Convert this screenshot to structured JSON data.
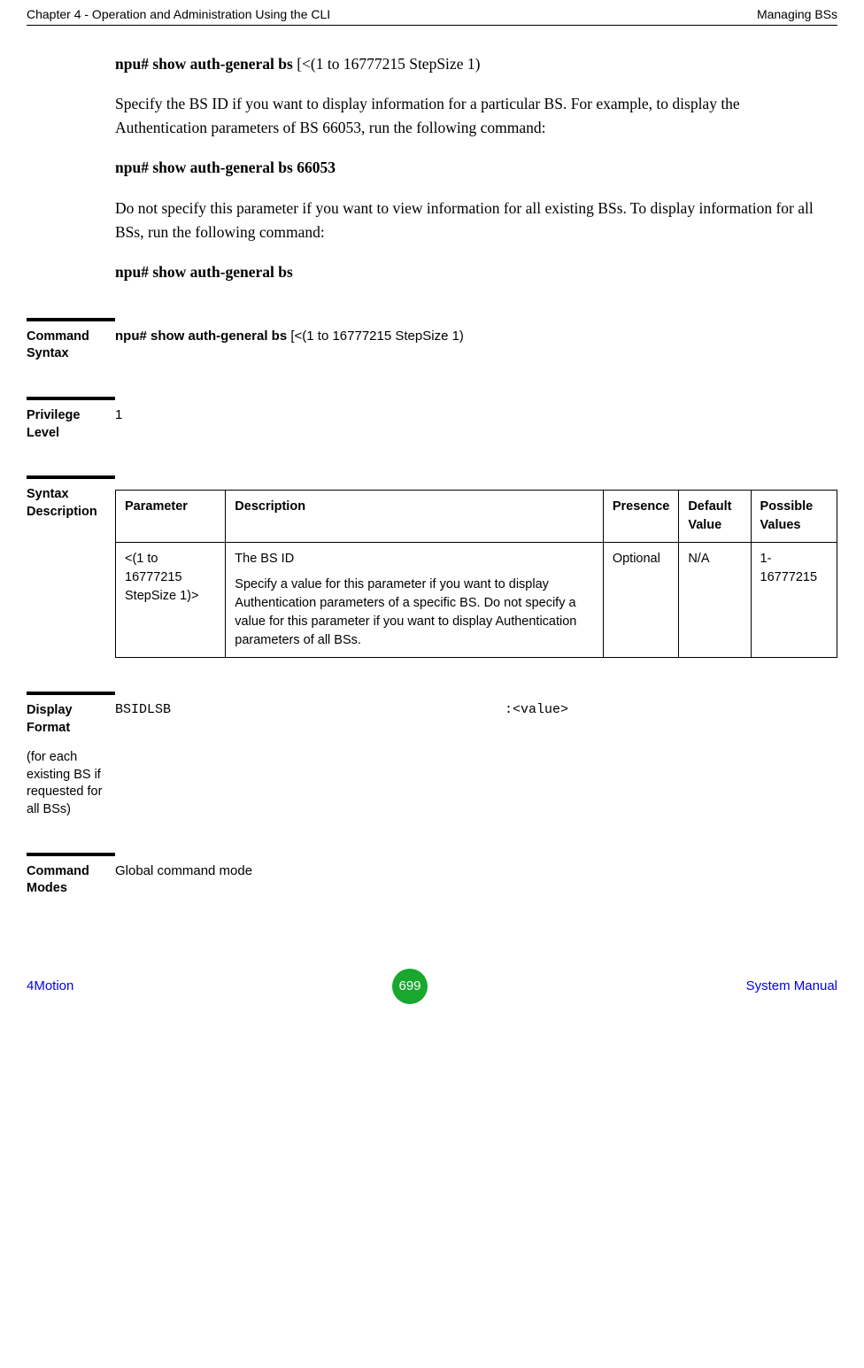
{
  "header": {
    "left": "Chapter 4 - Operation and Administration Using the CLI",
    "right": "Managing BSs"
  },
  "body": {
    "cmd1_prefix": "npu# show auth-general bs ",
    "cmd1_suffix": "[<(1 to 16777215 StepSize 1)",
    "p1": "Specify the BS ID if you want to display information for a particular BS. For example, to display the Authentication parameters of BS 66053, run the following command:",
    "cmd2": "npu# show auth-general bs 66053",
    "p2": "Do not specify this parameter if you want to view information for all existing BSs. To display information for all BSs, run the following command:",
    "cmd3": "npu# show auth-general bs"
  },
  "sections": {
    "command_syntax": {
      "label": "Command Syntax",
      "value_bold": "npu# show auth-general bs ",
      "value_rest": "[<(1 to 16777215 StepSize 1)"
    },
    "privilege_level": {
      "label": "Privilege Level",
      "value": "1"
    },
    "syntax_description": {
      "label": "Syntax Description",
      "table": {
        "headers": {
          "parameter": "Parameter",
          "description": "Description",
          "presence": "Presence",
          "default_value": "Default Value",
          "possible_values": "Possible Values"
        },
        "row": {
          "parameter": "<(1 to 16777215 StepSize 1)>",
          "description_p1": "The BS ID",
          "description_p2": "Specify a value for this parameter if you want to display Authentication parameters of a specific BS. Do not specify a value for this parameter if you want to display Authentication parameters of all BSs.",
          "presence": "Optional",
          "default_value": "N/A",
          "possible_values": "1-16777215"
        }
      }
    },
    "display_format": {
      "label": "Display Format",
      "sublabel": "(for each existing BS if requested for all BSs)",
      "key": "BSIDLSB",
      "value": ":<value>"
    },
    "command_modes": {
      "label": "Command Modes",
      "value": "Global command mode"
    }
  },
  "footer": {
    "left": "4Motion",
    "page": "699",
    "right": "System Manual"
  }
}
